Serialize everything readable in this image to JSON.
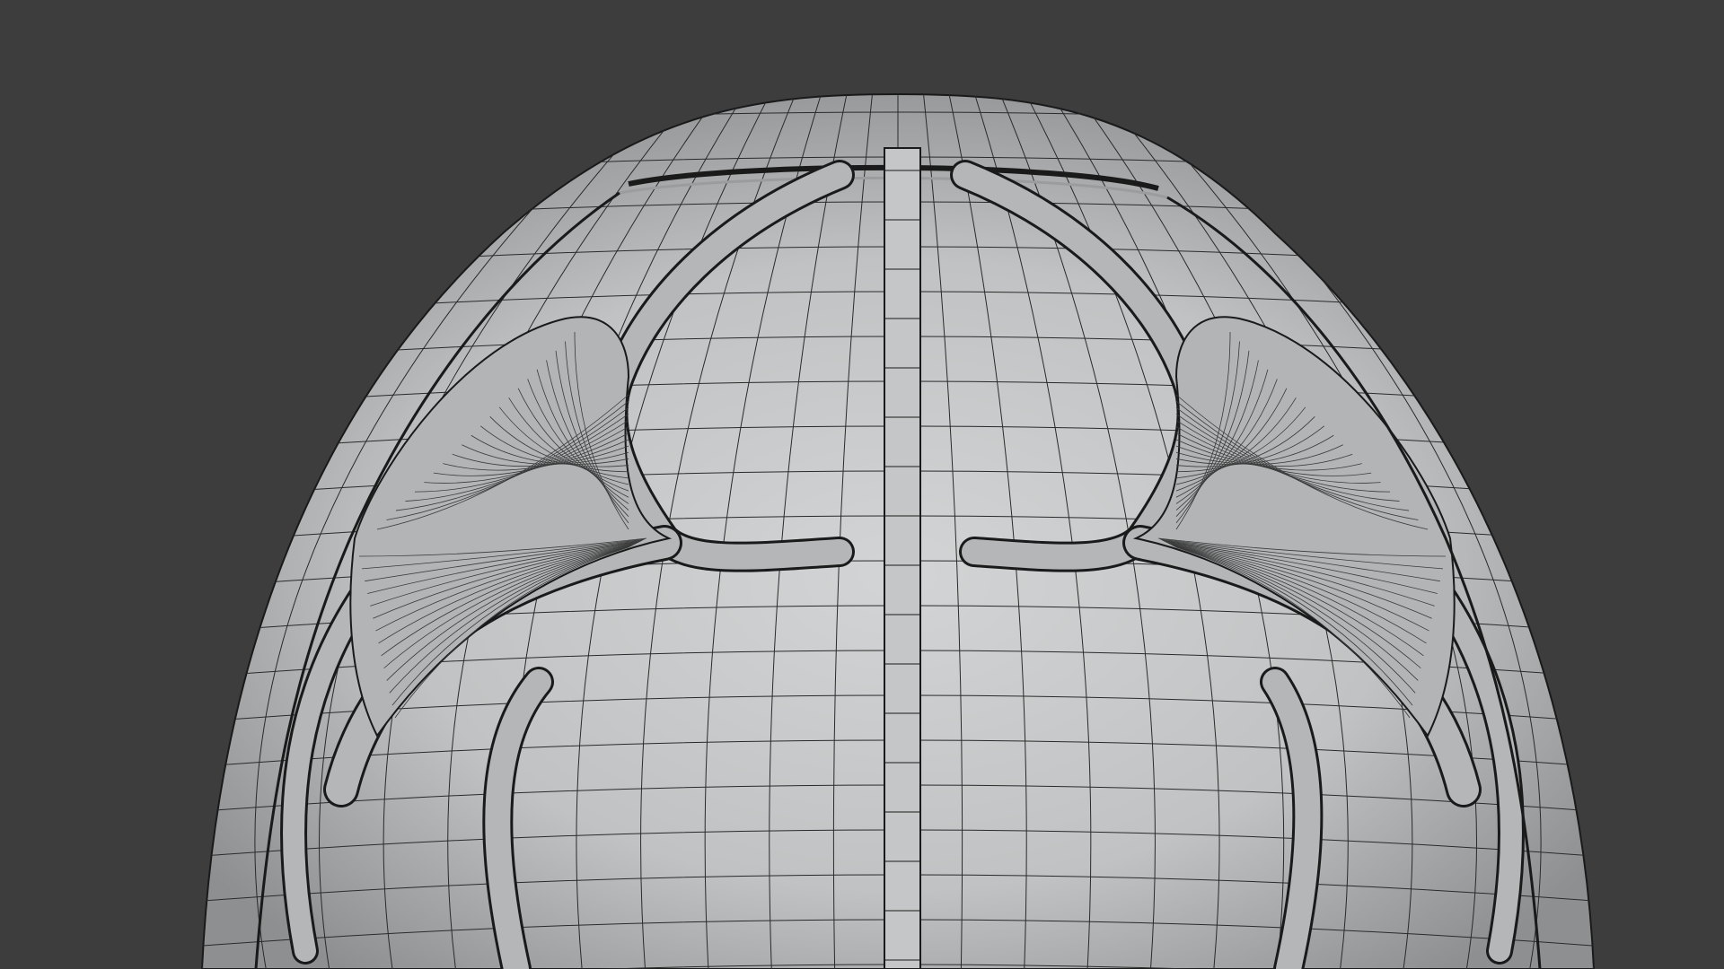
{
  "viewport": {
    "background_color": "#3d3d3d",
    "mesh_color": "#c2c4c5",
    "mesh_shadow_color": "#8f9193",
    "wire_color": "#1a1a1a",
    "display_mode": "solid-with-wireframe"
  },
  "object": {
    "shape": "egg",
    "features": [
      "center-spine-strip",
      "left-rib-frame",
      "right-rib-frame",
      "left-panel",
      "right-panel",
      "top-cap-seam",
      "lower-ring"
    ]
  }
}
